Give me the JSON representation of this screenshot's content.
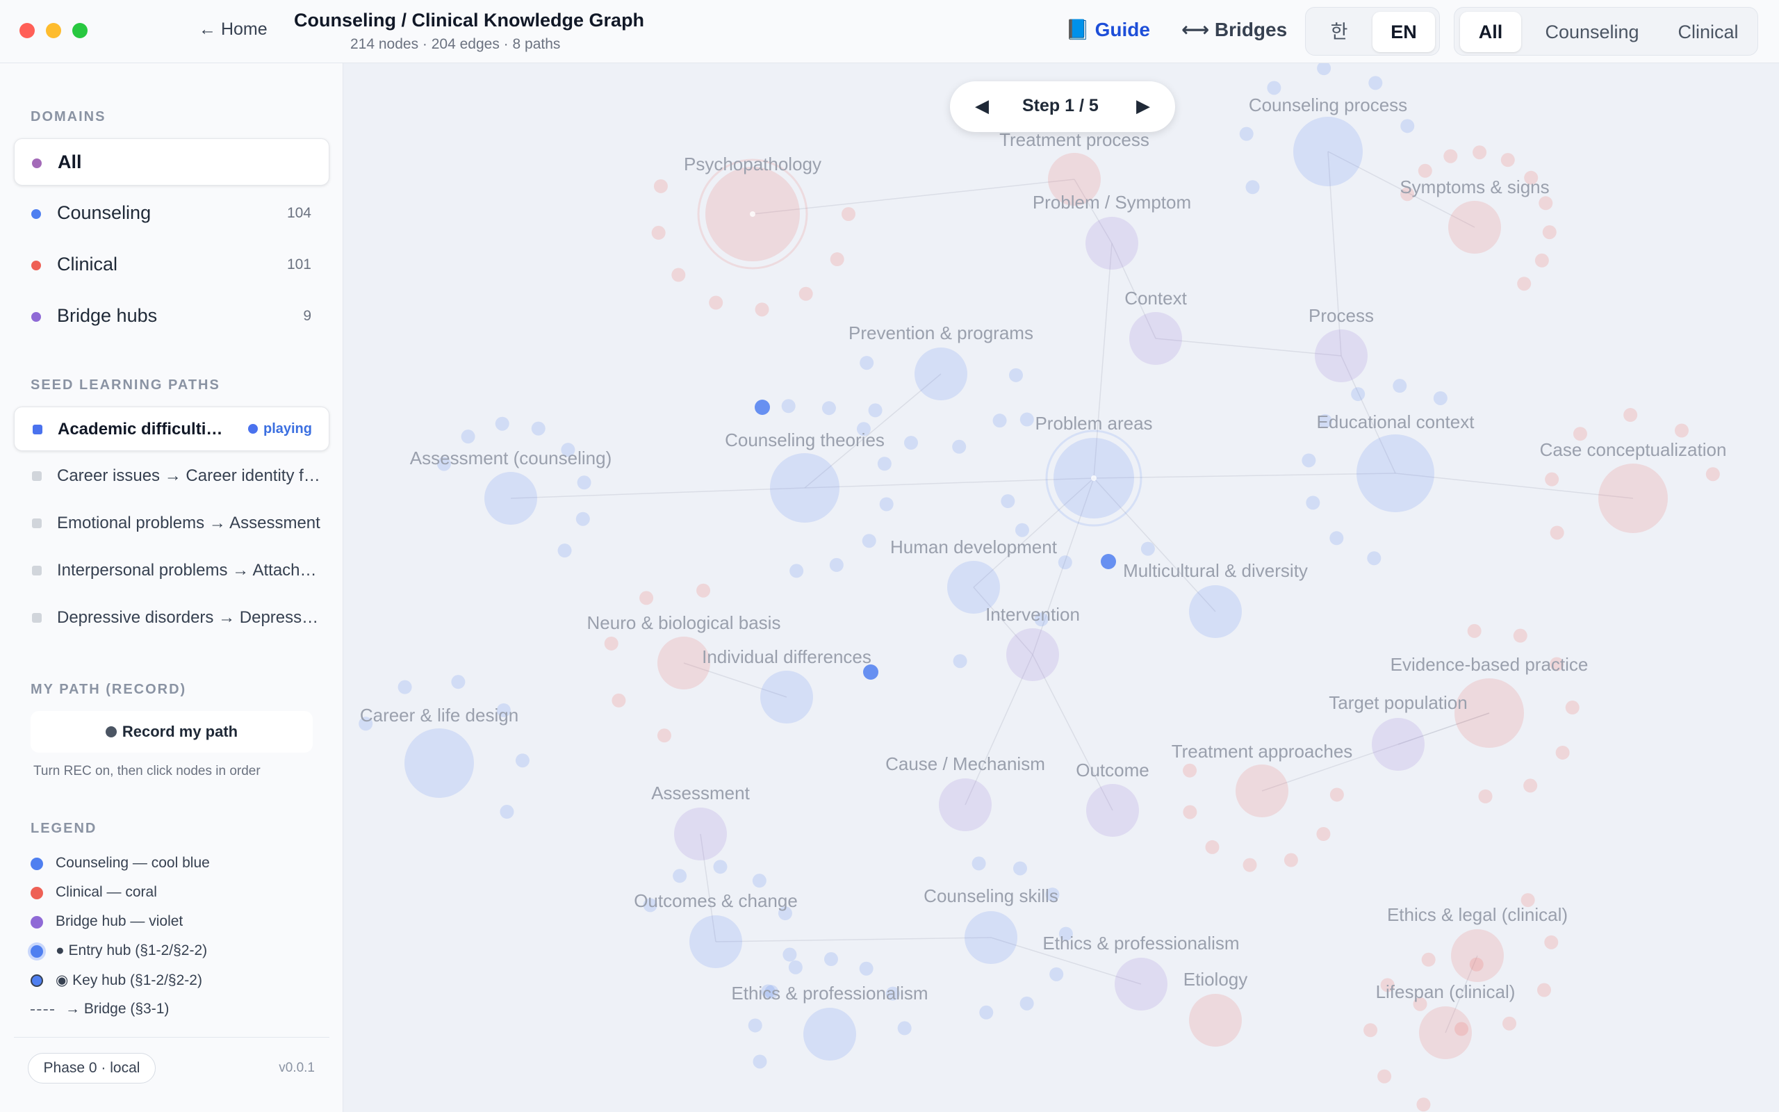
{
  "header": {
    "home_label": "← Home",
    "title": "Counseling / Clinical Knowledge Graph",
    "stats": "214 nodes · 204 edges · 8 paths",
    "guide_label": "📘 Guide",
    "bridges_label": "⟷ Bridges",
    "lang": [
      "한",
      "EN"
    ],
    "scope": [
      "All",
      "Counseling",
      "Clinical"
    ]
  },
  "sidebar": {
    "domains_heading": "DOMAINS",
    "domains": [
      {
        "label": "All",
        "count": "",
        "color": "#a36ab8"
      },
      {
        "label": "Counseling",
        "count": "104",
        "color": "#4f7ff0"
      },
      {
        "label": "Clinical",
        "count": "101",
        "color": "#ee6055"
      },
      {
        "label": "Bridge hubs",
        "count": "9",
        "color": "#8f6ad6"
      }
    ],
    "paths_heading": "SEED LEARNING PATHS",
    "paths": [
      {
        "label": "Academic difficulties → Academic support"
      },
      {
        "label": "Career issues → Career identity formation"
      },
      {
        "label": "Emotional problems → Assessment"
      },
      {
        "label": "Interpersonal problems → Attachment"
      },
      {
        "label": "Depressive disorders → Depression care"
      }
    ],
    "playing_label": "playing",
    "record_heading": "MY PATH (RECORD)",
    "record_button": "Record my path",
    "record_hint": "Turn REC on, then click nodes in order",
    "legend_heading": "LEGEND",
    "legend": [
      "Counseling — cool blue",
      "Clinical — coral",
      "Bridge hub — violet",
      "● Entry hub (§1-2/§2-2)",
      "◉ Key hub (§1-2/§2-2)",
      "→ Bridge (§3-1)"
    ],
    "phase": "Phase 0 · local",
    "version": "v0.0.1"
  },
  "step": {
    "prev": "◀",
    "label": "Step 1 / 5",
    "next": "▶"
  },
  "colors": {
    "counseling": "#4f7ff0",
    "clinical": "#ee6055",
    "bridge": "#8f6ad6",
    "accent": "#1d4ed8"
  },
  "graph": {
    "hubs": [
      {
        "label": "Psychopathology",
        "type": "clinical"
      },
      {
        "label": "Treatment process",
        "type": "clinical"
      },
      {
        "label": "Problem / Symptom",
        "type": "bridge"
      },
      {
        "label": "Counseling process",
        "type": "counseling"
      },
      {
        "label": "Symptoms & signs",
        "type": "clinical"
      },
      {
        "label": "Context",
        "type": "bridge"
      },
      {
        "label": "Process",
        "type": "bridge"
      },
      {
        "label": "Prevention & programs",
        "type": "counseling"
      },
      {
        "label": "Problem areas",
        "type": "counseling"
      },
      {
        "label": "Educational context",
        "type": "counseling"
      },
      {
        "label": "Case conceptualization",
        "type": "clinical"
      },
      {
        "label": "Assessment (counseling)",
        "type": "counseling"
      },
      {
        "label": "Counseling theories",
        "type": "counseling"
      },
      {
        "label": "Human development",
        "type": "counseling"
      },
      {
        "label": "Multicultural & diversity",
        "type": "counseling"
      },
      {
        "label": "Intervention",
        "type": "bridge"
      },
      {
        "label": "Neuro & biological basis",
        "type": "clinical"
      },
      {
        "label": "Individual differences",
        "type": "counseling"
      },
      {
        "label": "Career & life design",
        "type": "counseling"
      },
      {
        "label": "Evidence-based practice",
        "type": "clinical"
      },
      {
        "label": "Target population",
        "type": "bridge"
      },
      {
        "label": "Treatment approaches",
        "type": "clinical"
      },
      {
        "label": "Cause / Mechanism",
        "type": "bridge"
      },
      {
        "label": "Outcome",
        "type": "bridge"
      },
      {
        "label": "Assessment",
        "type": "bridge"
      },
      {
        "label": "Outcomes & change",
        "type": "counseling"
      },
      {
        "label": "Counseling skills",
        "type": "counseling"
      },
      {
        "label": "Ethics & legal (clinical)",
        "type": "clinical"
      },
      {
        "label": "Ethics & professionalism",
        "type": "bridge"
      },
      {
        "label": "Etiology",
        "type": "clinical"
      },
      {
        "label": "Lifespan (clinical)",
        "type": "clinical"
      },
      {
        "label": "Ethics & professionalism",
        "type": "counseling"
      }
    ]
  }
}
